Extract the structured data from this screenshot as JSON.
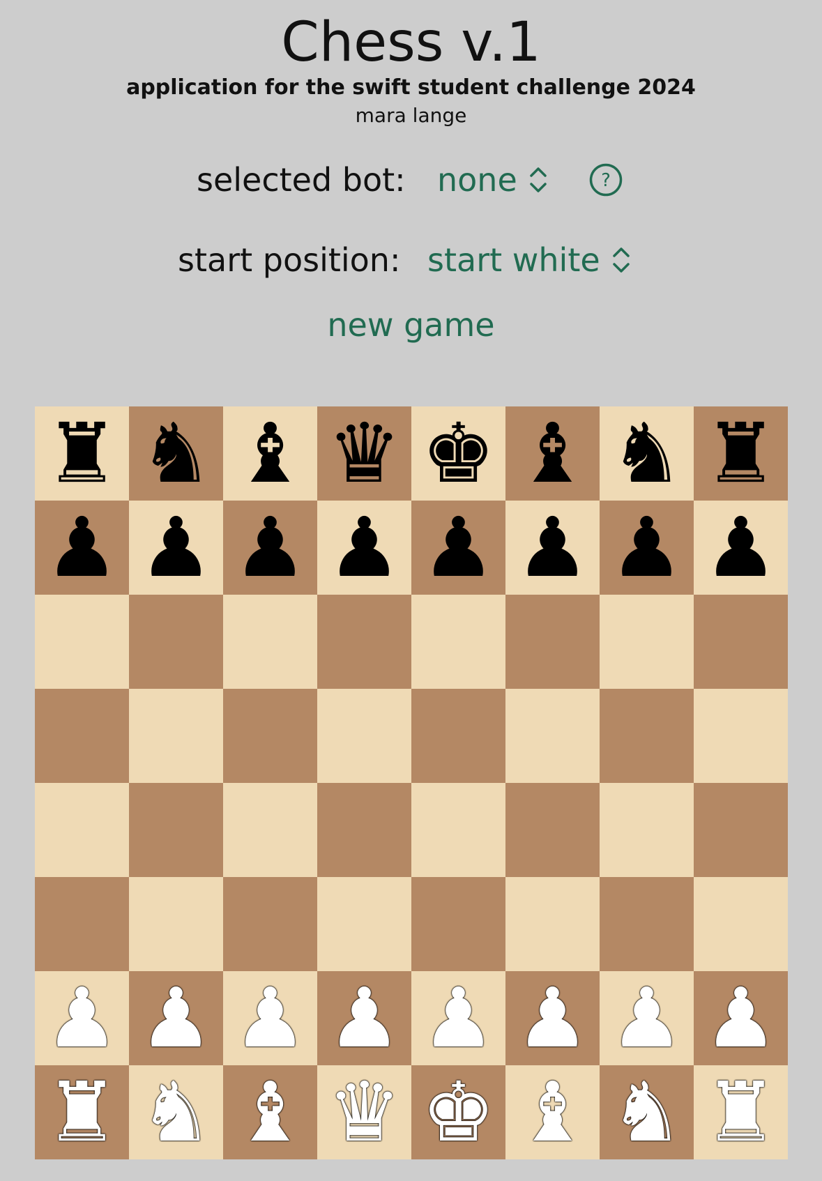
{
  "header": {
    "title": "Chess v.1",
    "subtitle": "application for the swift student challenge 2024",
    "author": "mara lange"
  },
  "controls": {
    "bot_label": "selected bot:",
    "bot_value": "none",
    "position_label": "start position:",
    "position_value": "start white",
    "new_game_label": "new game",
    "help_icon": "question-circle-icon",
    "picker_icon": "chevron-up-down-icon"
  },
  "colors": {
    "accent": "#216b51",
    "background": "#cdcdcd",
    "light_square": "#efdab5",
    "dark_square": "#b48864"
  },
  "board": {
    "rows": [
      [
        "bR",
        "bN",
        "bB",
        "bQ",
        "bK",
        "bB",
        "bN",
        "bR"
      ],
      [
        "bP",
        "bP",
        "bP",
        "bP",
        "bP",
        "bP",
        "bP",
        "bP"
      ],
      [
        "",
        "",
        "",
        "",
        "",
        "",
        "",
        ""
      ],
      [
        "",
        "",
        "",
        "",
        "",
        "",
        "",
        ""
      ],
      [
        "",
        "",
        "",
        "",
        "",
        "",
        "",
        ""
      ],
      [
        "",
        "",
        "",
        "",
        "",
        "",
        "",
        ""
      ],
      [
        "wP",
        "wP",
        "wP",
        "wP",
        "wP",
        "wP",
        "wP",
        "wP"
      ],
      [
        "wR",
        "wN",
        "wB",
        "wQ",
        "wK",
        "wB",
        "wN",
        "wR"
      ]
    ]
  }
}
